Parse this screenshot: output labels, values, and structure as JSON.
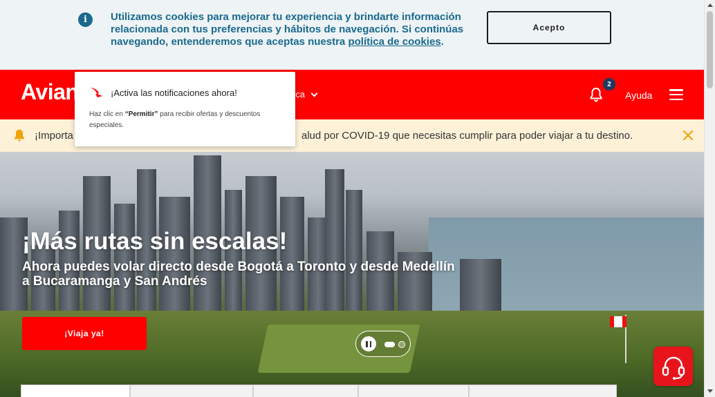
{
  "cookie_banner": {
    "text_prefix": "Utilizamos cookies para mejorar tu experiencia y brindarte información relacionada con tus preferencias y hábitos de navegación. Si continúas navegando, entenderemos que aceptas nuestra ",
    "link": "política de cookies",
    "text_suffix": ".",
    "accept_label": "Acepto",
    "info_glyph": "i"
  },
  "header": {
    "logo": "Avian",
    "nav_fragment": "nca",
    "notification_count": "2",
    "help_label": "Ayuda",
    "colors": {
      "brand": "#ff0000",
      "badge": "#1c3b5e"
    }
  },
  "notification_popup": {
    "title": "¡Activa las notificaciones ahora!",
    "body_prefix": "Haz clic en ",
    "body_bold": "“Permitir”",
    "body_suffix": " para recibir ofertas y descuentos especiales."
  },
  "alert": {
    "text_start": "¡Importa",
    "text_end": "alud por COVID-19 que necesitas cumplir para poder viajar a tu destino."
  },
  "hero": {
    "title": "¡Más rutas sin escalas!",
    "subtitle": "Ahora puedes volar directo desde Bogotá a Toronto y desde Medellín a Bucaramanga y San Andrés",
    "cta_label": "¡Viaja ya!",
    "carousel": {
      "slides": 2,
      "active_slide": 1
    }
  },
  "icons": [
    "info-icon",
    "bell-icon",
    "chevron-down-icon",
    "menu-icon",
    "alert-bell-icon",
    "close-icon",
    "pause-icon",
    "headset-icon",
    "avianca-bird-icon"
  ]
}
